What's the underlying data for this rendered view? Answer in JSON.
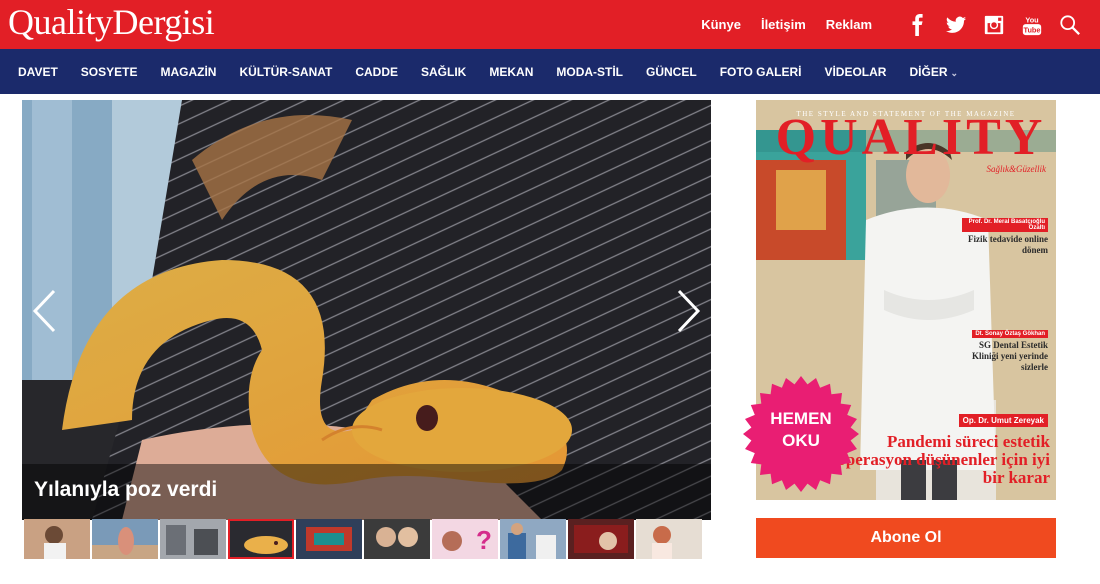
{
  "header": {
    "logo": "QualityDergisi",
    "links": [
      "Künye",
      "İletişim",
      "Reklam"
    ],
    "social_icons": [
      "facebook-icon",
      "twitter-icon",
      "instagram-icon",
      "youtube-icon",
      "search-icon"
    ],
    "youtube_label": "You Tube",
    "brand_color": "#e21f26"
  },
  "nav": {
    "items": [
      "DAVET",
      "SOSYETE",
      "MAGAZİN",
      "KÜLTÜR-SANAT",
      "CADDE",
      "SAĞLIK",
      "MEKAN",
      "MODA-STİL",
      "GÜNCEL",
      "FOTO GALERİ",
      "VİDEOLAR",
      "DİĞER"
    ],
    "more_icon": "chevron-down-icon",
    "background": "#1b2a6b"
  },
  "slider": {
    "caption": "Yılanıyla poz verdi",
    "active_thumb": 3,
    "thumb_count": 10
  },
  "magazine": {
    "tagline": "THE STYLE AND STATEMENT OF THE MAGAZINE",
    "title": "QUALITY",
    "subtitle": "Sağlık&Güzellik",
    "block1_name": "Prof. Dr. Meral Basatçıoğlu Özaltı",
    "block1_text": "Fizik tedavide online dönem",
    "block2_name": "Dt. Sonay Öztaş Gökhan",
    "block2_text": "SG Dental Estetik Kliniği yeni yerinde sizlerle",
    "badge_name": "Op. Dr. Umut Zereyak",
    "headline": "Pandemi süreci estetik operasyon düşünenler için iyi bir karar"
  },
  "cta": {
    "read_now": "HEMEN OKU",
    "subscribe": "Abone Ol",
    "subscribe_color": "#f04a1f"
  }
}
